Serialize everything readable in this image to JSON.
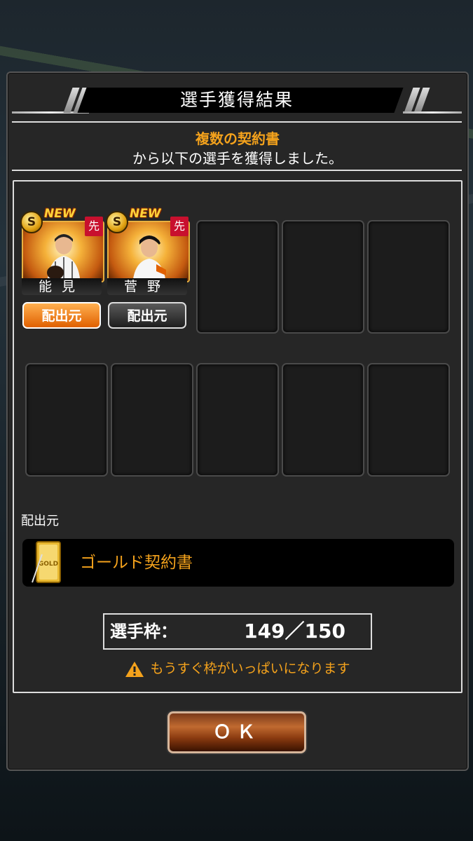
{
  "dialog": {
    "title": "選手獲得結果",
    "source_name": "複数の契約書",
    "acquired_message": "から以下の選手を獲得しました。"
  },
  "cards": [
    {
      "name": "能見",
      "new_label": "NEW",
      "rank": "S",
      "position": "先",
      "source_button": "配出元"
    },
    {
      "name": "菅野",
      "new_label": "NEW",
      "rank": "S",
      "position": "先",
      "source_button": "配出元"
    }
  ],
  "source": {
    "label": "配出元",
    "item_name": "ゴールド契約書",
    "icon": "gold-contract-icon"
  },
  "player_slots": {
    "label": "選手枠：",
    "value": "149／150"
  },
  "warning": {
    "text": "もうすぐ枠がいっぱいになります",
    "icon": "warning-icon"
  },
  "ok_button": "ＯＫ",
  "colors": {
    "accent_orange": "#f4a21c",
    "position_red": "#c8102e"
  }
}
